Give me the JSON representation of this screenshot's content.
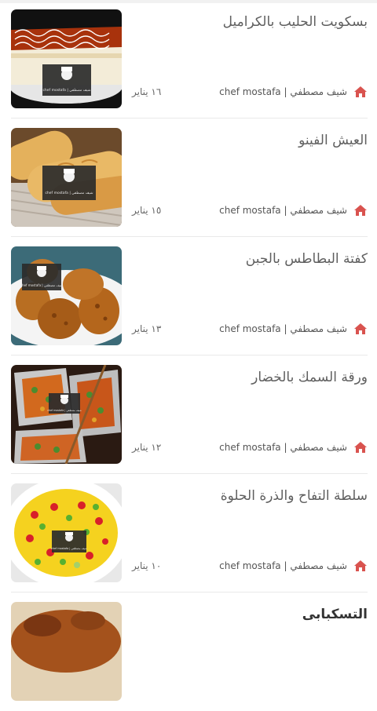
{
  "recipes": [
    {
      "title": "بسكويت الحليب بالكراميل",
      "author": "chef mostafa | شيف مصطفي",
      "date": "١٦ يناير",
      "image": "caramel-biscuit-cake"
    },
    {
      "title": "العيش الفينو",
      "author": "chef mostafa | شيف مصطفي",
      "date": "١٥ يناير",
      "image": "fino-bread"
    },
    {
      "title": "كفتة البطاطس بالجبن",
      "author": "chef mostafa | شيف مصطفي",
      "date": "١٣ يناير",
      "image": "potato-cheese-kofta"
    },
    {
      "title": "ورقة السمك بالخضار",
      "author": "chef mostafa | شيف مصطفي",
      "date": "١٢ يناير",
      "image": "fish-foil-vegetables"
    },
    {
      "title": "سلطة التفاح والذرة الحلوة",
      "author": "chef mostafa | شيف مصطفي",
      "date": "١٠ يناير",
      "image": "apple-corn-salad"
    },
    {
      "title": "التسكبابى",
      "image": "tasqababi-dish"
    }
  ],
  "watermark": "chef mostafa | شيف مصطفي",
  "icons": {
    "author": "home-icon"
  },
  "colors": {
    "icon": "#d9534f",
    "title": "#5f5f5f",
    "divider": "#e9e9e9"
  }
}
